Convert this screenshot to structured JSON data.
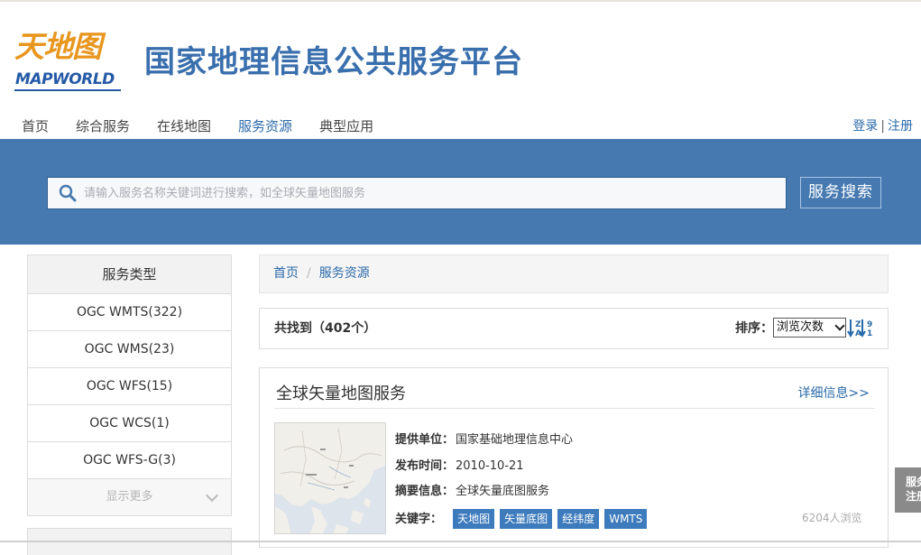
{
  "header": {
    "logo_cn": "天地图",
    "logo_en": "MAPWORLD",
    "site_title": "国家地理信息公共服务平台"
  },
  "nav": {
    "items": [
      {
        "label": "首页"
      },
      {
        "label": "综合服务"
      },
      {
        "label": "在线地图"
      },
      {
        "label": "服务资源",
        "active": true
      },
      {
        "label": "典型应用"
      }
    ],
    "login": "登录",
    "separator": "|",
    "register": "注册"
  },
  "search": {
    "placeholder": "请输入服务名称关键词进行搜索，如全球矢量地图服务",
    "value": "",
    "button": "服务搜索",
    "icon": "search-icon"
  },
  "sidebar": {
    "title": "服务类型",
    "items": [
      {
        "label": "OGC WMTS(322)"
      },
      {
        "label": "OGC WMS(23)"
      },
      {
        "label": "OGC WFS(15)"
      },
      {
        "label": "OGC WCS(1)"
      },
      {
        "label": "OGC WFS-G(3)"
      }
    ],
    "more": "显示更多"
  },
  "breadcrumb": {
    "items": [
      "首页",
      "服务资源"
    ],
    "separator": "/"
  },
  "results": {
    "found_text": "共找到（402个）",
    "sort_label": "排序：",
    "sort_selected": "浏览次数",
    "sort_icon": "sort-alpha-icon"
  },
  "card": {
    "title": "全球矢量地图服务",
    "detail_link": "详细信息>>",
    "provider_label": "提供单位：",
    "provider": "国家基础地理信息中心",
    "date_label": "发布时间：",
    "date": "2010-10-21",
    "summary_label": "摘要信息：",
    "summary": "全球矢量底图服务",
    "keywords_label": "关键字：",
    "keywords": [
      "天地图",
      "矢量底图",
      "经纬度",
      "WMTS"
    ],
    "views": "6204人浏览"
  },
  "side_tab": {
    "line1": "服务",
    "line2": "注册"
  },
  "colors": {
    "brand_blue": "#4579b0",
    "link_blue": "#2a6aaa",
    "logo_orange": "#e8961e",
    "tag_blue": "#3d7bbd"
  }
}
